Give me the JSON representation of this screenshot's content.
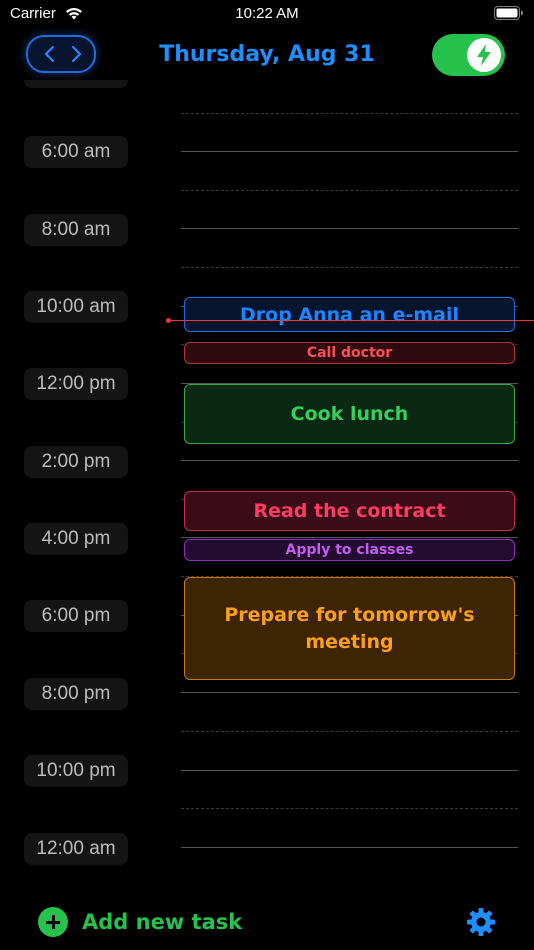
{
  "status_bar": {
    "carrier": "Carrier",
    "time": "10:22 AM",
    "icons": [
      "wifi-icon",
      "battery-icon"
    ]
  },
  "header": {
    "nav_icons": [
      "chevron-left-icon",
      "chevron-right-icon"
    ],
    "date_title": "Thursday, Aug 31",
    "toggle": {
      "state": "on",
      "icon": "lightning-bolt-icon"
    }
  },
  "timeline": {
    "hours": [
      "6:00 am",
      "8:00 am",
      "10:00 am",
      "12:00 pm",
      "2:00 pm",
      "4:00 pm",
      "6:00 pm",
      "8:00 pm",
      "10:00 pm",
      "12:00 am"
    ]
  },
  "tasks": [
    {
      "title": "Drop Anna an e-mail",
      "color": "#2184ff"
    },
    {
      "title": "Call doctor",
      "color": "#ff4d57"
    },
    {
      "title": "Cook lunch",
      "color": "#33d15a"
    },
    {
      "title": "Read the contract",
      "color": "#ff3c64"
    },
    {
      "title": "Apply to classes",
      "color": "#c45cf0"
    },
    {
      "title": "Prepare for tomorrow's meeting",
      "color": "#ff9f1a"
    }
  ],
  "footer": {
    "add_label": "Add new task",
    "icons": [
      "plus-circle-icon",
      "gear-icon"
    ]
  },
  "colors": {
    "accent_blue": "#1f8fff",
    "accent_green": "#27c24c",
    "now_indicator": "#e8393a"
  }
}
